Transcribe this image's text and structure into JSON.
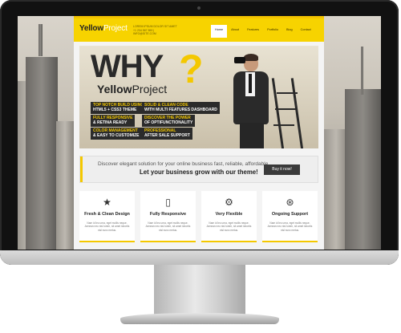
{
  "site": {
    "logo_brand": "Yellow",
    "logo_rest": "Project",
    "contact": [
      "LOREM IPSUM DOLOR SIT AMET",
      "+1 234 567 890 | INFO@SITE.COM"
    ],
    "nav": [
      "Home",
      "About",
      "Features",
      "Portfolio",
      "Blog",
      "Contact"
    ],
    "active_nav": "Home"
  },
  "hero": {
    "headline": "WHY",
    "question_mark": "?",
    "subtitle_brand": "Yellow",
    "subtitle_rest": "Project",
    "features": [
      {
        "line1": "TOP NOTCH BUILD USING",
        "line2": "HTML5 + CSS3 THEME"
      },
      {
        "line1": "SOLID & CLEAN CODE",
        "line2": "WITH MULTI FEATURES DASHBOARD"
      },
      {
        "line1": "FULLY RESPONSIVE",
        "line2": "& RETINA READY"
      },
      {
        "line1": "DISCOVER THE POWER",
        "line2": "OF OPTIFUNCTIONALITY"
      },
      {
        "line1": "COLOR MANAGEMENT",
        "line2": "& EASY TO CUSTOMIZE"
      },
      {
        "line1": "PROFESSIONAL",
        "line2": "AFTER SALE SUPPORT"
      }
    ]
  },
  "banner": {
    "line1": "Discover elegant solution for your online business fast, reliable, affordable.",
    "line2": "Let your business grow with our theme!",
    "button": "Buy it now!"
  },
  "features": [
    {
      "icon": "star-icon",
      "glyph": "★",
      "title": "Fresh & Clean Design",
      "text": "Nam id leo urna, eget mollis neque. Aenean nec nisl lorem, sit amet lobortis nisl nunc metus."
    },
    {
      "icon": "phone-icon",
      "glyph": "▯",
      "title": "Fully Responsive",
      "text": "Nam id leo urna, eget mollis neque. Aenean nec nisl lorem, sit amet lobortis nisl nunc metus."
    },
    {
      "icon": "gear-icon",
      "glyph": "⚙",
      "title": "Very Flexible",
      "text": "Nam id leo urna, eget mollis neque. Aenean nec nisl lorem, sit amet lobortis nisl nunc metus."
    },
    {
      "icon": "lifebuoy-icon",
      "glyph": "⊛",
      "title": "Ongoing Support",
      "text": "Nam id leo urna, eget mollis neque. Aenean nec nisl lorem, sit amet lobortis nisl nunc metus."
    }
  ],
  "colors": {
    "accent": "#f4c800",
    "dark": "#2b2b2b",
    "bezel": "#111111"
  }
}
